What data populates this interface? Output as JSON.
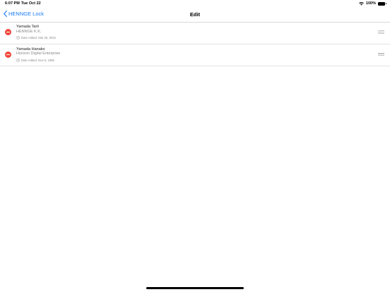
{
  "status_bar": {
    "time": "6:07 PM",
    "date": "Tue Oct 22",
    "battery": "100%"
  },
  "nav": {
    "back_label": "HENNGE Lock",
    "title": "Edit"
  },
  "accounts": [
    {
      "name": "Yamada Tarō",
      "org": "HENNGE K.K.",
      "date_added": "Date Added: Mar 25, 2015"
    },
    {
      "name": "Yamada Hanako",
      "org": "Horizon Digital Enterprise",
      "date_added": "Date Added: Nov 5, 1996"
    }
  ],
  "colors": {
    "accent": "#1a7cf5",
    "delete": "#f0483e",
    "secondary_text": "#8a8a8a"
  },
  "icons": {
    "back": "chevron-left-icon",
    "delete": "minus-circle-icon",
    "date": "clock-icon",
    "reorder": "reorder-handle-icon",
    "wifi": "wifi-icon",
    "battery": "battery-icon"
  }
}
